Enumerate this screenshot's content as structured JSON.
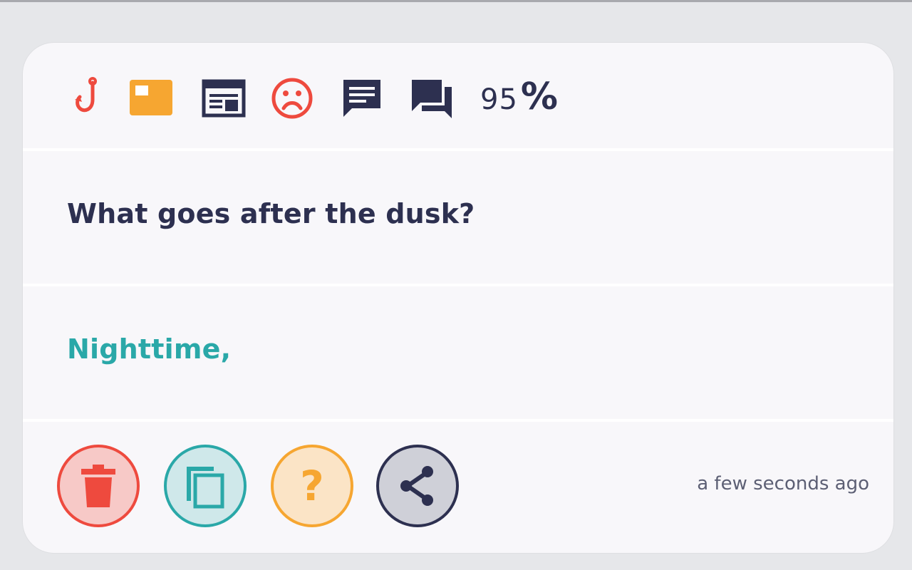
{
  "card": {
    "toolbar": {
      "icons": [
        {
          "name": "hook-icon",
          "color": "#ee4a3e"
        },
        {
          "name": "card-image-icon",
          "color": "#f6a631"
        },
        {
          "name": "calendar-table-icon",
          "color": "#2d3050"
        },
        {
          "name": "sad-face-icon",
          "color": "#ee4a3e"
        },
        {
          "name": "chat-bubble-icon",
          "color": "#2d3050"
        },
        {
          "name": "forum-icon",
          "color": "#2d3050"
        }
      ],
      "percent_value": "95",
      "percent_sign": "%"
    },
    "question": "What goes after the dusk?",
    "answer": "Nighttime,",
    "actions": {
      "delete_icon": "trash-icon",
      "copy_icon": "copy-icon",
      "help_label": "?",
      "share_icon": "share-icon"
    },
    "timestamp": "a few seconds ago"
  },
  "colors": {
    "red": "#ee4a3e",
    "teal": "#2aa8a8",
    "orange": "#f6a631",
    "navy": "#2d3050",
    "card_bg": "#f8f7fa"
  }
}
